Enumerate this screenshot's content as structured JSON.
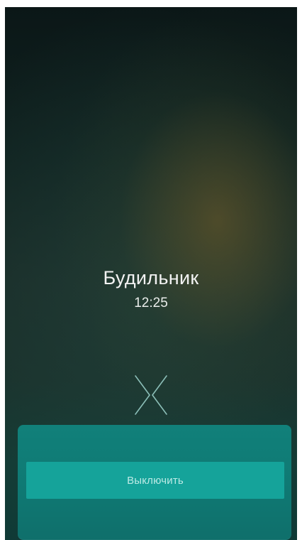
{
  "alarm": {
    "title": "Будильник",
    "time": "12:25"
  },
  "actions": {
    "dismiss_label": "Выключить",
    "swipe_icon": "swipe-chevrons-icon"
  },
  "colors": {
    "accent": "#15a39a",
    "panel": "#0f7a74",
    "text": "#f2f2f2"
  }
}
